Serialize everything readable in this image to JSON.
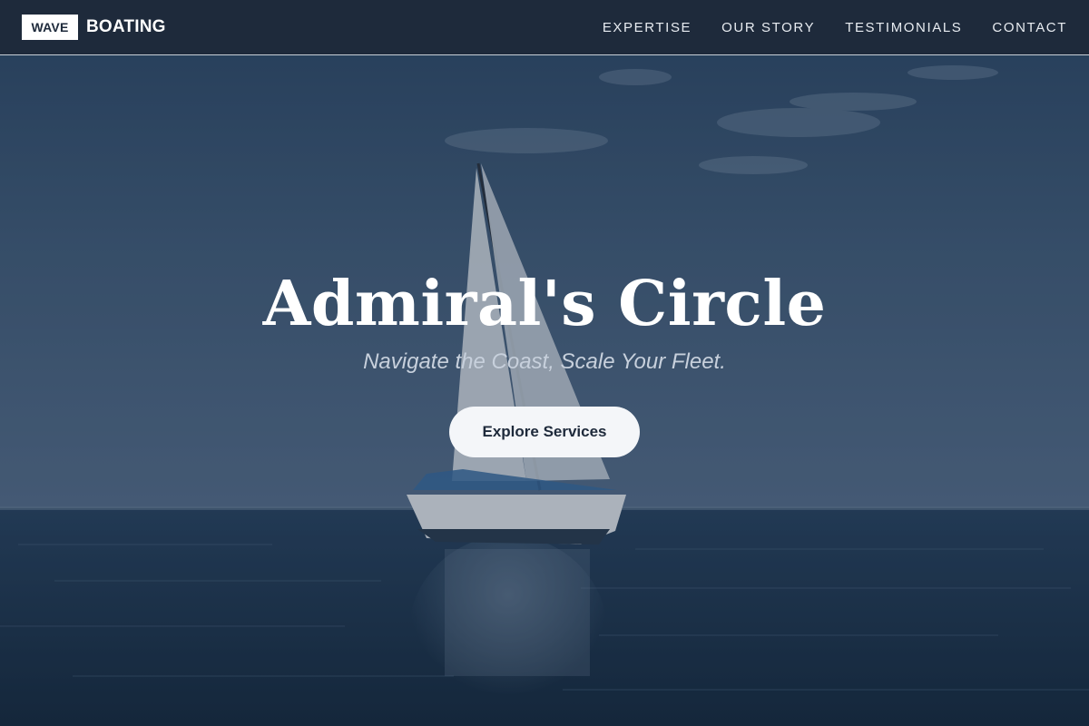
{
  "brand": {
    "badge": "WAVE",
    "name": "BOATING"
  },
  "nav": {
    "items": [
      {
        "label": "EXPERTISE"
      },
      {
        "label": "OUR STORY"
      },
      {
        "label": "TESTIMONIALS"
      },
      {
        "label": "CONTACT"
      }
    ]
  },
  "hero": {
    "title": "Admiral's Circle",
    "subtitle": "Navigate the Coast, Scale Your Fleet.",
    "cta_label": "Explore Services"
  },
  "colors": {
    "navbar_bg": "#1e2a3b",
    "sky": "#3d5a7a",
    "sea": "#1f3650",
    "button_bg": "#f4f6f9",
    "button_text": "#1e2a3b"
  }
}
